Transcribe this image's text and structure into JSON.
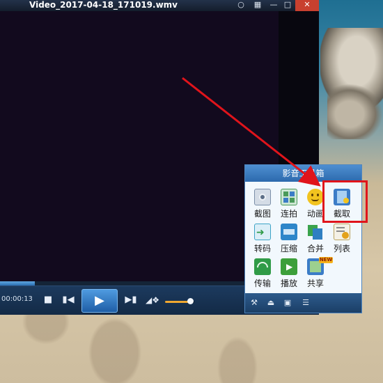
{
  "window": {
    "title": "Video_2017-04-18_171019.wmv",
    "buttons": [
      "chat-icon",
      "menu-icon",
      "minimize-icon",
      "maximize-icon",
      "close-icon"
    ]
  },
  "playback": {
    "time": "00:00:13",
    "progress_fraction": 0.11,
    "volume_fraction": 0.85
  },
  "toolbox": {
    "title": "影音工具箱",
    "tools": [
      {
        "label": "截图",
        "icon": "camera-icon",
        "color": "#7a8ea8"
      },
      {
        "label": "连拍",
        "icon": "grid-icon",
        "color": "#4a9a5a"
      },
      {
        "label": "动画",
        "icon": "gif-smiley-icon",
        "color": "#f1c31f"
      },
      {
        "label": "截取",
        "icon": "film-cut-icon",
        "color": "#3b7cc7"
      },
      {
        "label": "转码",
        "icon": "convert-icon",
        "color": "#3ca3c6"
      },
      {
        "label": "压缩",
        "icon": "compress-icon",
        "color": "#2e86c9"
      },
      {
        "label": "合并",
        "icon": "merge-icon",
        "color": "#3aa34d"
      },
      {
        "label": "列表",
        "icon": "list-gear-icon",
        "color": "#e3a21b"
      },
      {
        "label": "传输",
        "icon": "wifi-transfer-icon",
        "color": "#2f9b47"
      },
      {
        "label": "播放",
        "icon": "film-play-icon",
        "color": "#3c9f3a"
      },
      {
        "label": "共享",
        "icon": "share-film-icon",
        "color": "#3b7cc7"
      }
    ],
    "new_badge": "NEW",
    "footer_buttons": [
      "wrench-icon",
      "eject-icon",
      "skin-icon",
      "playlist-icon"
    ]
  }
}
